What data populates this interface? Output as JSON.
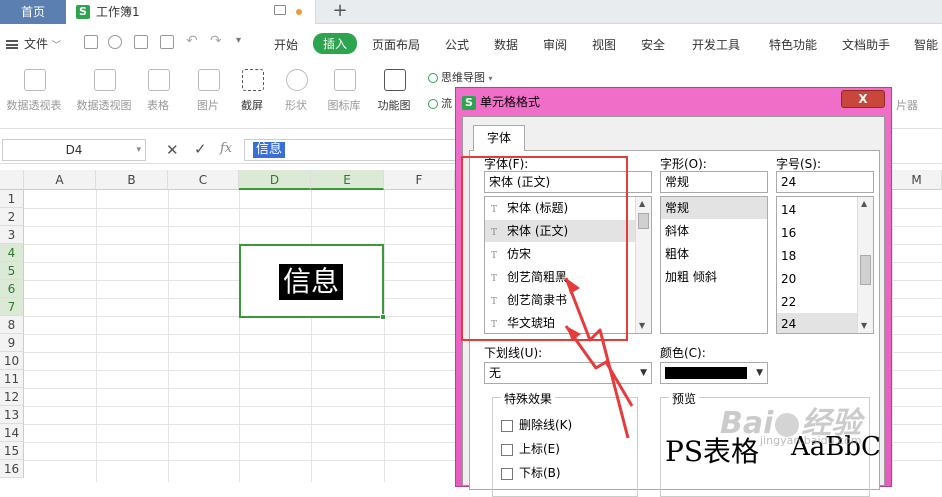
{
  "titlebar": {
    "home_tab": "首页",
    "doc_tab": "工作簿1",
    "app_letter": "S",
    "new_tab": "+"
  },
  "menubar": {
    "file": "文件",
    "items": [
      "开始",
      "插入",
      "页面布局",
      "公式",
      "数据",
      "审阅",
      "视图",
      "安全",
      "开发工具",
      "特色功能",
      "文档助手",
      "智能"
    ],
    "active": "插入"
  },
  "ribbon": {
    "buttons": [
      {
        "label": "数据透视表",
        "enabled": false
      },
      {
        "label": "数据透视图",
        "enabled": false
      },
      {
        "label": "表格",
        "enabled": false
      },
      {
        "label": "图片",
        "enabled": false
      },
      {
        "label": "截屏",
        "enabled": true
      },
      {
        "label": "形状",
        "enabled": false
      },
      {
        "label": "图标库",
        "enabled": false
      },
      {
        "label": "功能图",
        "enabled": true
      }
    ],
    "mindmap": "思维导图",
    "flow_partial": "流",
    "right_partial": "片器"
  },
  "formula_bar": {
    "cell_ref": "D4",
    "cancel": "✕",
    "confirm": "✓",
    "fx": "fx",
    "value": "信息"
  },
  "grid": {
    "columns": [
      "A",
      "B",
      "C",
      "D",
      "E",
      "F",
      "M"
    ],
    "rows": [
      "1",
      "2",
      "3",
      "4",
      "5",
      "6",
      "7",
      "8",
      "9",
      "10",
      "11",
      "12",
      "13",
      "14",
      "15",
      "16"
    ],
    "selected_cell_text": "信息"
  },
  "dialog": {
    "title": "单元格格式",
    "close": "X",
    "tab": "字体",
    "font_label": "字体(F):",
    "font_value": "宋体 (正文)",
    "font_list": [
      "宋体 (标题)",
      "宋体 (正文)",
      "仿宋",
      "创艺简粗黑",
      "创艺简隶书",
      "华文琥珀"
    ],
    "font_selected": "宋体 (正文)",
    "style_label": "字形(O):",
    "style_value": "常规",
    "style_list": [
      "常规",
      "斜体",
      "粗体",
      "加粗 倾斜"
    ],
    "style_selected": "常规",
    "size_label": "字号(S):",
    "size_value": "24",
    "size_list": [
      "14",
      "16",
      "18",
      "20",
      "22",
      "24"
    ],
    "size_selected": "24",
    "underline_label": "下划线(U):",
    "underline_value": "无",
    "color_label": "颜色(C):",
    "color_value": "#000000",
    "effects_label": "特殊效果",
    "effects": [
      "删除线(K)",
      "上标(E)",
      "下标(B)"
    ],
    "preview_label": "预览",
    "preview_cn": "PS表格",
    "preview_en": "AaBbC"
  },
  "watermark": {
    "text_left": "Bai",
    "text_right": "经验",
    "sub": "jingyan.baidu.com"
  },
  "colors": {
    "accent": "#2da44e",
    "selection": "#3a9a3a",
    "dialog_frame": "#e85bbe",
    "annotation": "#e63b3b"
  }
}
